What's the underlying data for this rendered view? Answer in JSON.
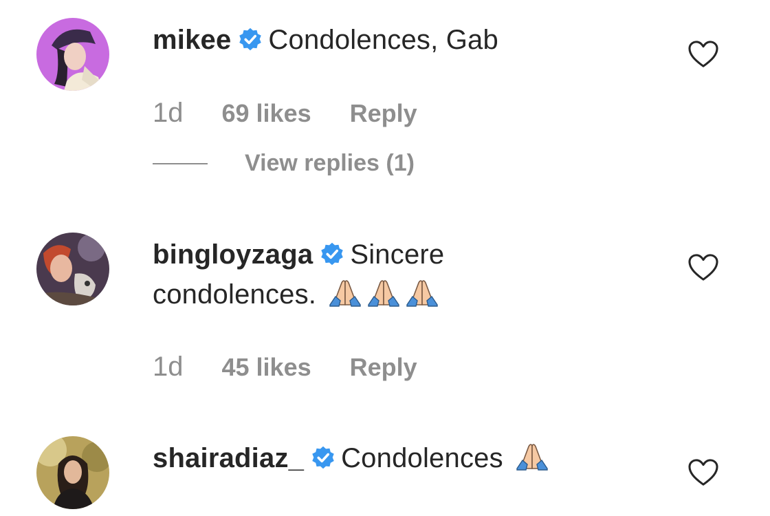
{
  "comments": [
    {
      "username": "mikee",
      "verified": true,
      "text": "Condolences, Gab",
      "emoji": [],
      "time": "1d",
      "likes": "69 likes",
      "reply": "Reply",
      "view_replies": "View replies (1)"
    },
    {
      "username": "bingloyzaga",
      "verified": true,
      "text_line1": "Sincere",
      "text_line2": "condolences.",
      "emoji": [
        "folded-hands",
        "folded-hands",
        "folded-hands"
      ],
      "time": "1d",
      "likes": "45 likes",
      "reply": "Reply"
    },
    {
      "username": "shairadiaz_",
      "verified": true,
      "text": "Condolences",
      "emoji": [
        "folded-hands"
      ]
    }
  ],
  "colors": {
    "verified_blue": "#3897f0",
    "meta_gray": "#8e8e8e",
    "text_dark": "#262626"
  }
}
